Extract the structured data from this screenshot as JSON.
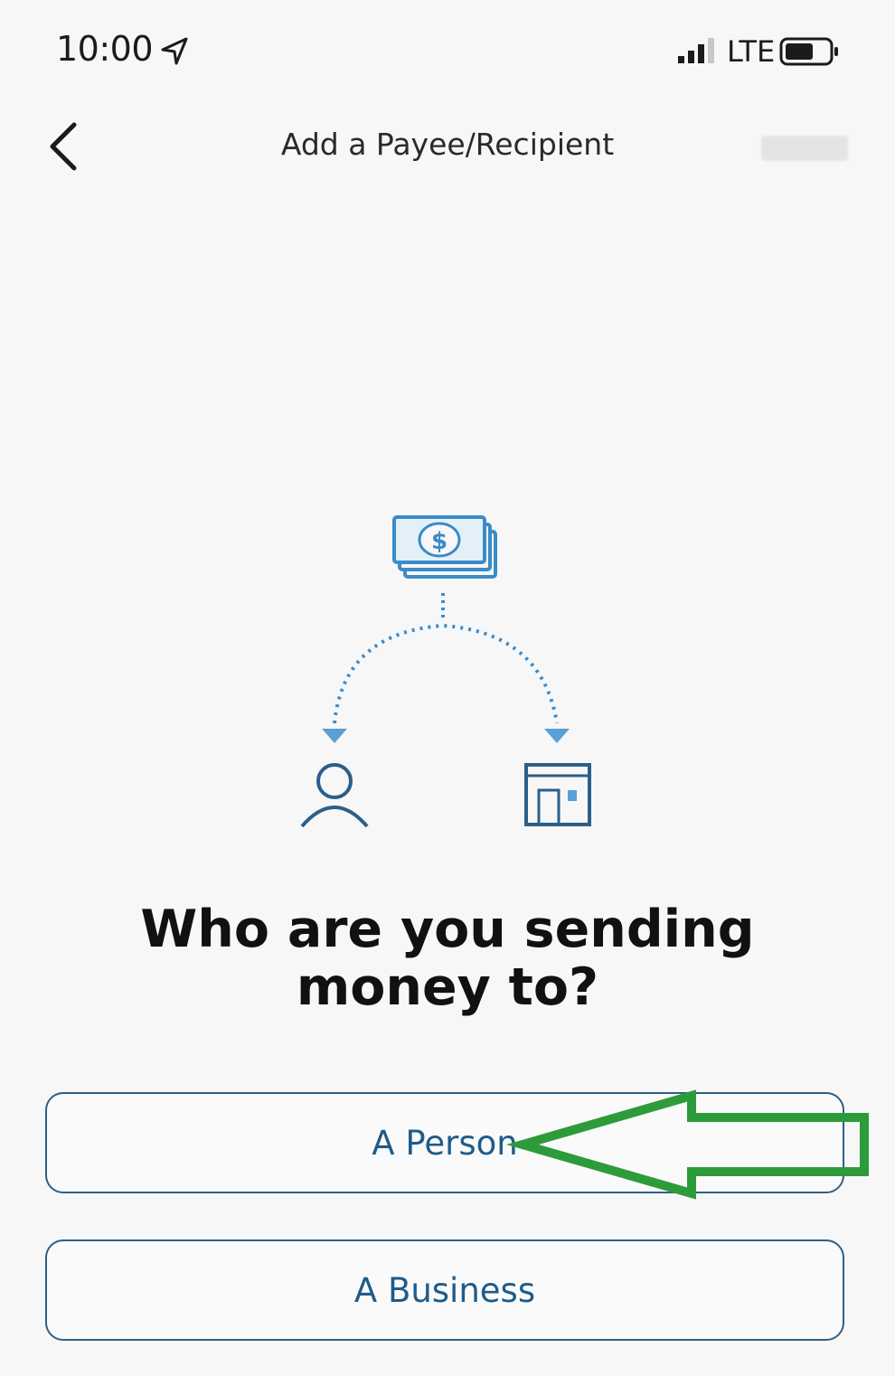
{
  "status_bar": {
    "time": "10:00",
    "network": "LTE",
    "icons": [
      "location-arrow-icon",
      "signal-icon",
      "battery-icon"
    ]
  },
  "nav": {
    "title": "Add a Payee/Recipient",
    "back_icon": "chevron-left-icon"
  },
  "illustration": {
    "icons": [
      "money-stack-icon",
      "person-icon",
      "business-building-icon"
    ],
    "accent_color": "#3a8bc9"
  },
  "prompt": {
    "heading_line1": "Who are you sending",
    "heading_line2": "money to?"
  },
  "options": {
    "person_label": "A Person",
    "business_label": "A Business"
  },
  "annotation": {
    "arrow_color": "#2e9b3a",
    "points_to": "A Person"
  },
  "colors": {
    "button_border": "#2f5f86",
    "button_text": "#1d5c8a",
    "background": "#f7f7f7"
  }
}
